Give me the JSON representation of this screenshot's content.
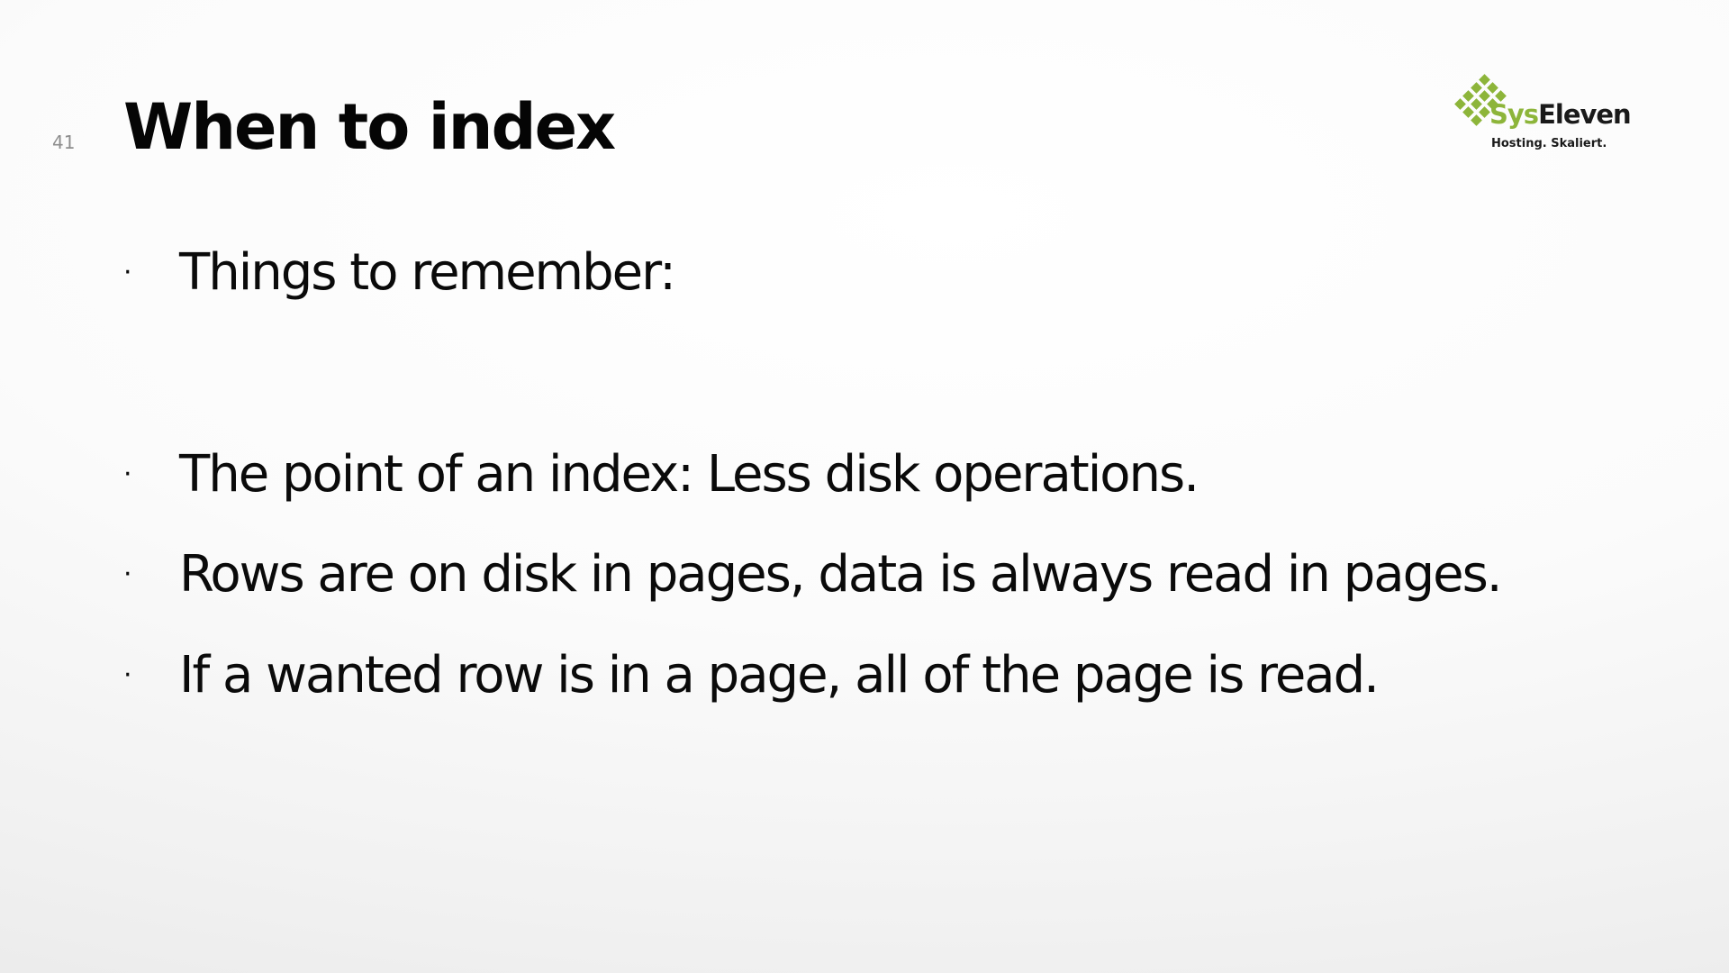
{
  "slide": {
    "number": "41",
    "title": "When to index"
  },
  "bullets": [
    {
      "marker": "·",
      "text": "Things to remember:"
    },
    {
      "marker": "·",
      "text": "The point of an index: Less disk operations."
    },
    {
      "marker": "·",
      "text": "Rows are on disk in pages, data is always read in pages."
    },
    {
      "marker": "·",
      "text": "If a wanted row is in a page, all of the page is read."
    }
  ],
  "logo": {
    "wordmark_part1": "Sys",
    "wordmark_part2": "Eleven",
    "tagline": "Hosting. Skaliert.",
    "brand_color": "#8db53a",
    "text_color": "#1a1a1a"
  }
}
